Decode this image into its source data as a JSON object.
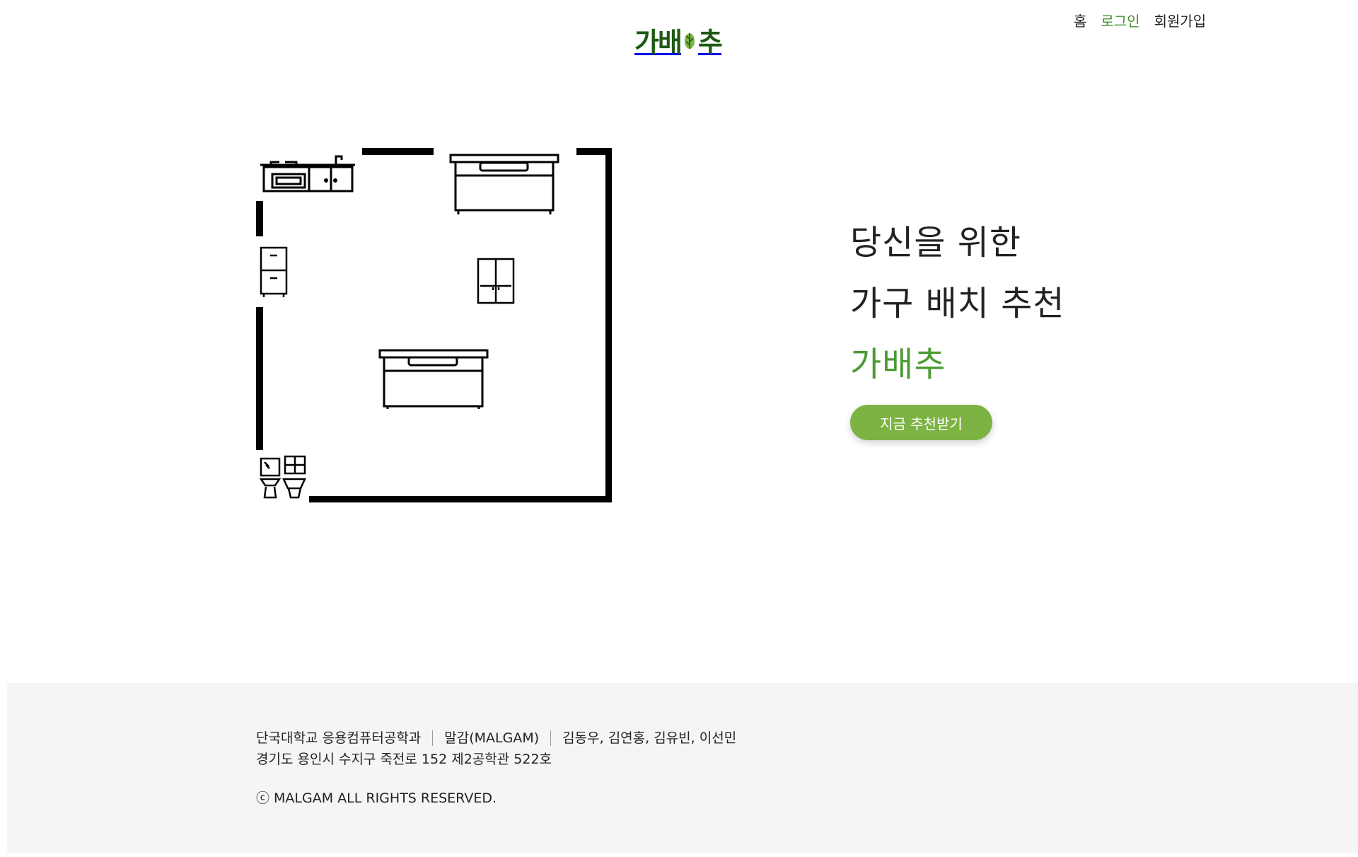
{
  "header": {
    "logo_text": "가배추",
    "logo_part1": "가배",
    "logo_part2": "추",
    "nav": [
      {
        "label": "홈"
      },
      {
        "label": "로그인"
      },
      {
        "label": "회원가입"
      }
    ]
  },
  "hero": {
    "line1": "당신을 위한",
    "line2": "가구 배치 추천",
    "brand": "가배추",
    "cta_label": "지금 추천받기"
  },
  "footer": {
    "university": "단국대학교 응용컴퓨터공학과",
    "team": "말감(MALGAM)",
    "members": "김동우, 김연홍, 김유빈, 이선민",
    "address": "경기도 용인시 수지구 죽전로 152 제2공학관 522호",
    "copyright": "ⓒ MALGAM ALL RIGHTS RESERVED."
  },
  "colors": {
    "logo": "#1f5a14",
    "brand_green": "#4d9a32",
    "nav_active": "#3f8f2b",
    "cta_bg": "#7cb342",
    "footer_bg": "#f5f5f5"
  },
  "icons": [
    "cabbage-icon",
    "kitchen-counter-icon",
    "bed-icon",
    "dresser-icon",
    "wardrobe-icon",
    "sink-icon",
    "toilet-icon"
  ]
}
